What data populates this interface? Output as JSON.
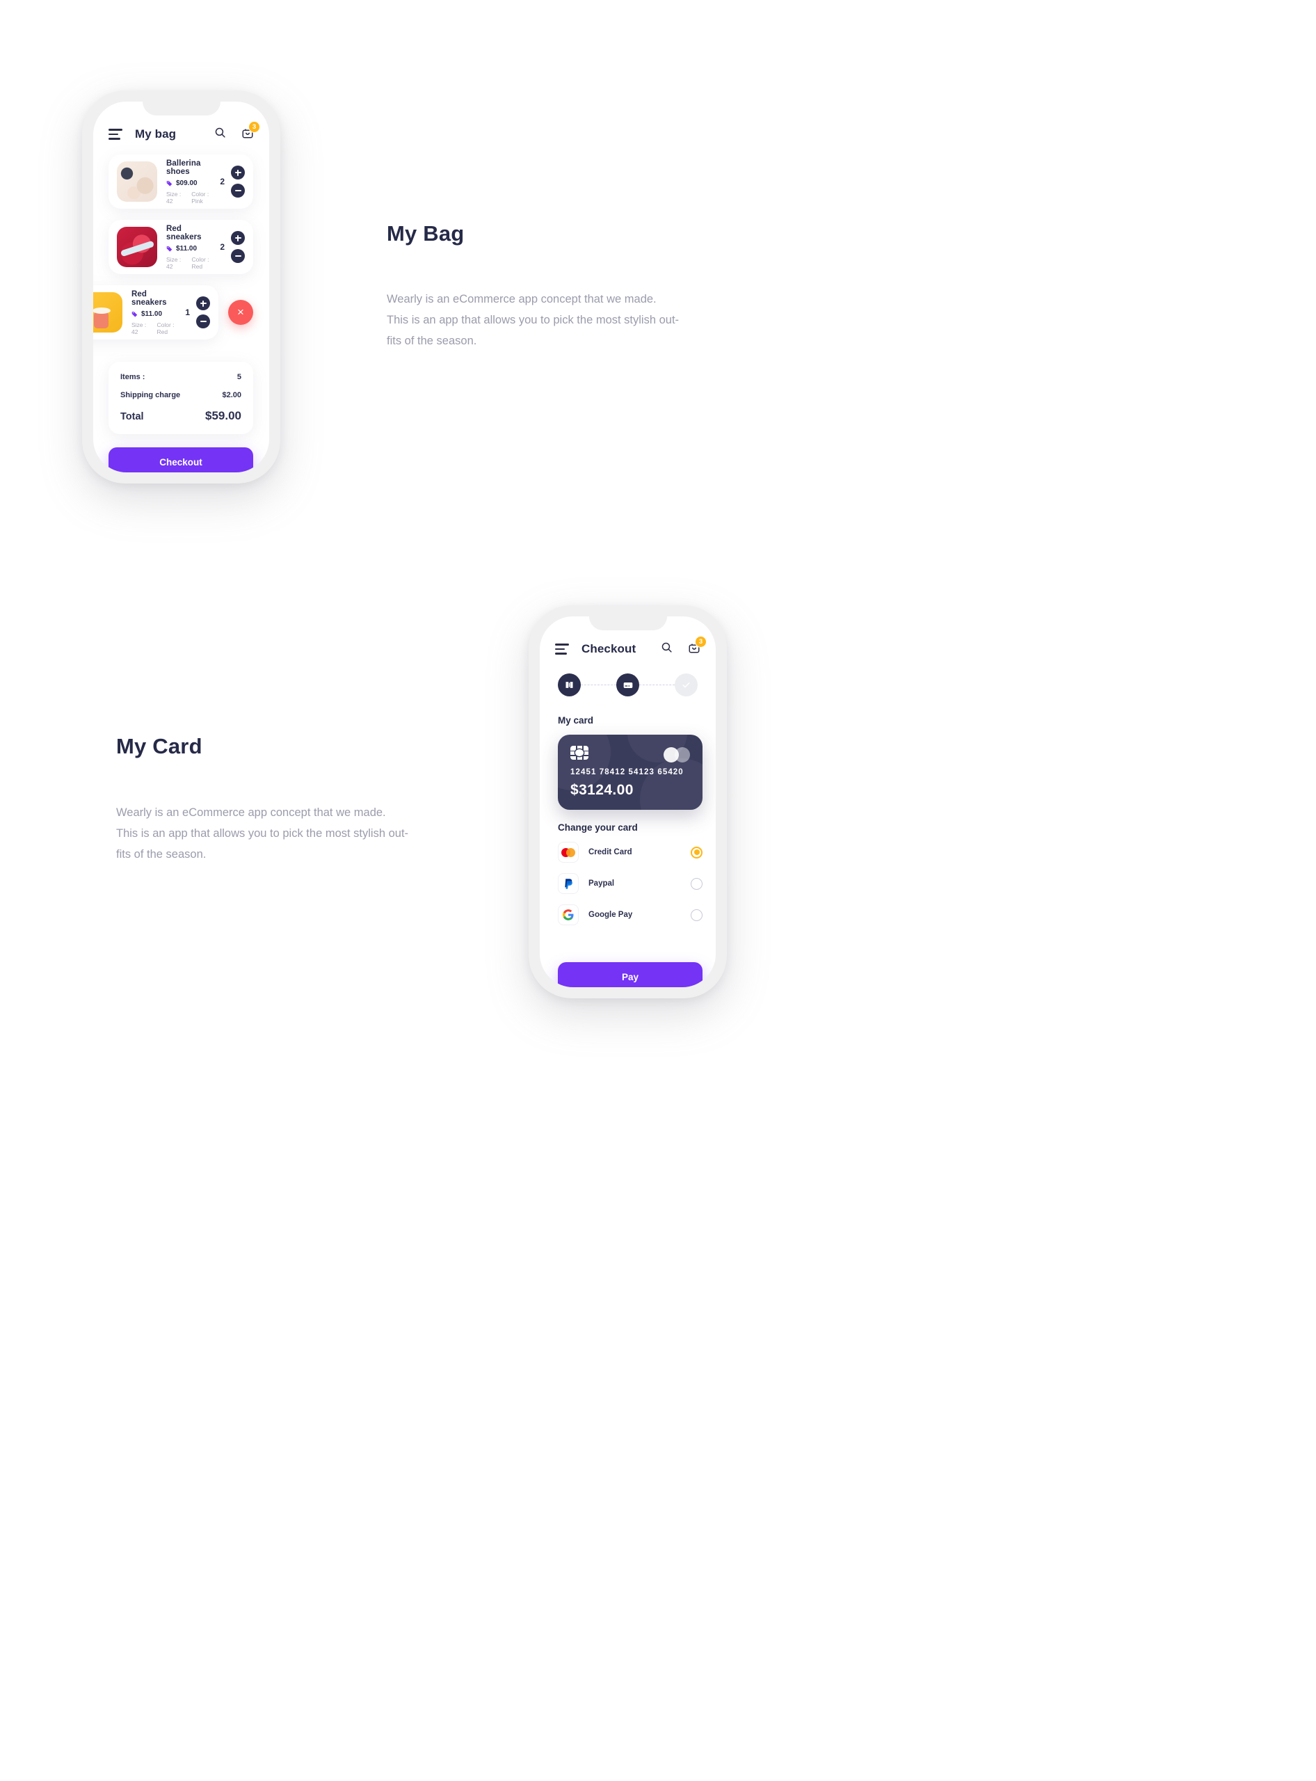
{
  "brand": {
    "accent_purple": "#7433f5",
    "dark_navy": "#2b2e4d",
    "amber": "#ffb617",
    "danger_red": "#fb5a5a",
    "muted_text": "#9b9cac"
  },
  "bag_screen": {
    "topbar": {
      "menu_label": "menu",
      "title": "My bag",
      "search_label": "Search",
      "bag_badge": "3"
    },
    "items": [
      {
        "name": "Ballerina shoes",
        "price": "$09.00",
        "size_label": "Size : 42",
        "color_label": "Color : Pink",
        "quantity": "2",
        "thumb_style": "ballerina",
        "swiped": false
      },
      {
        "name": "Red sneakers",
        "price": "$11.00",
        "size_label": "Size : 42",
        "color_label": "Color : Red",
        "quantity": "2",
        "thumb_style": "sneakers",
        "swiped": false
      },
      {
        "name": "Red sneakers",
        "price": "$11.00",
        "size_label": "Size : 42",
        "color_label": "Color : Red",
        "quantity": "1",
        "thumb_style": "yellow",
        "swiped": true,
        "delete_label": "×"
      }
    ],
    "summary": {
      "items_label": "Items :",
      "items_value": "5",
      "shipping_label": "Shipping charge",
      "shipping_value": "$2.00",
      "total_label": "Total",
      "total_value": "$59.00"
    },
    "checkout_button": "Checkout"
  },
  "bag_copy": {
    "heading": "My Bag",
    "line1": "Wearly is an eCommerce app concept that we made.",
    "line2": "This is an app that allows you to pick the most stylish out-",
    "line3": "fits of the season."
  },
  "card_copy": {
    "heading": "My Card",
    "line1": "Wearly is an eCommerce app concept that we made.",
    "line2": "This is an app that allows you to pick the most stylish out-",
    "line3": "fits of the season."
  },
  "checkout_screen": {
    "topbar": {
      "menu_label": "menu",
      "title": "Checkout",
      "search_label": "Search",
      "bag_badge": "3"
    },
    "steps": [
      {
        "name": "address-step",
        "icon": "book-icon",
        "state": "done"
      },
      {
        "name": "payment-step",
        "icon": "credit-card-icon",
        "state": "done"
      },
      {
        "name": "confirm-step",
        "icon": "check-icon",
        "state": "pending"
      }
    ],
    "my_card_title": "My card",
    "card": {
      "number": "12451  78412  54123  65420",
      "amount": "$3124.00",
      "chip_icon": "chip-icon",
      "brand_icon": "mastercard-icon"
    },
    "change_card_title": "Change your card",
    "methods": [
      {
        "label": "Credit Card",
        "logo": "mastercard-icon",
        "selected": true
      },
      {
        "label": "Paypal",
        "logo": "paypal-icon",
        "selected": false
      },
      {
        "label": "Google Pay",
        "logo": "google-icon",
        "selected": false
      }
    ],
    "pay_button": "Pay"
  }
}
